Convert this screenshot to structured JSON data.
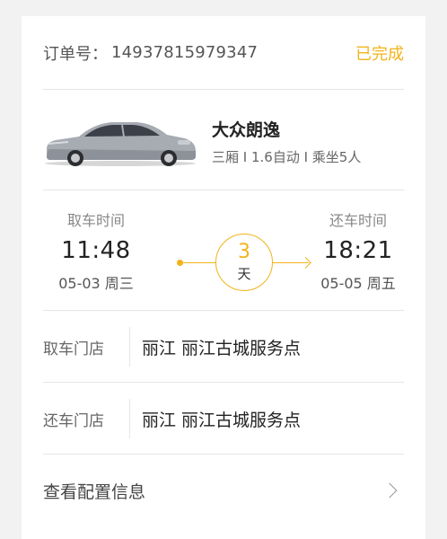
{
  "order": {
    "label": "订单号：",
    "number": "14937815979347",
    "status": "已完成"
  },
  "car": {
    "name": "大众朗逸",
    "spec": "三厢 I 1.6自动 I 乘坐5人"
  },
  "rental": {
    "pickup": {
      "label": "取车时间",
      "time": "11:48",
      "date": "05-03 周三"
    },
    "return": {
      "label": "还车时间",
      "time": "18:21",
      "date": "05-05 周五"
    },
    "days": "3",
    "days_unit": "天"
  },
  "stores": {
    "pickup": {
      "label": "取车门店",
      "name": "丽江 丽江古城服务点"
    },
    "return": {
      "label": "还车门店",
      "name": "丽江 丽江古城服务点"
    }
  },
  "config": {
    "label": "查看配置信息"
  },
  "colors": {
    "accent": "#f2b31b",
    "divider": "#e6e6e6",
    "background": "#f2f2f2"
  },
  "icons": {
    "chevron": "chevron-right-icon"
  }
}
